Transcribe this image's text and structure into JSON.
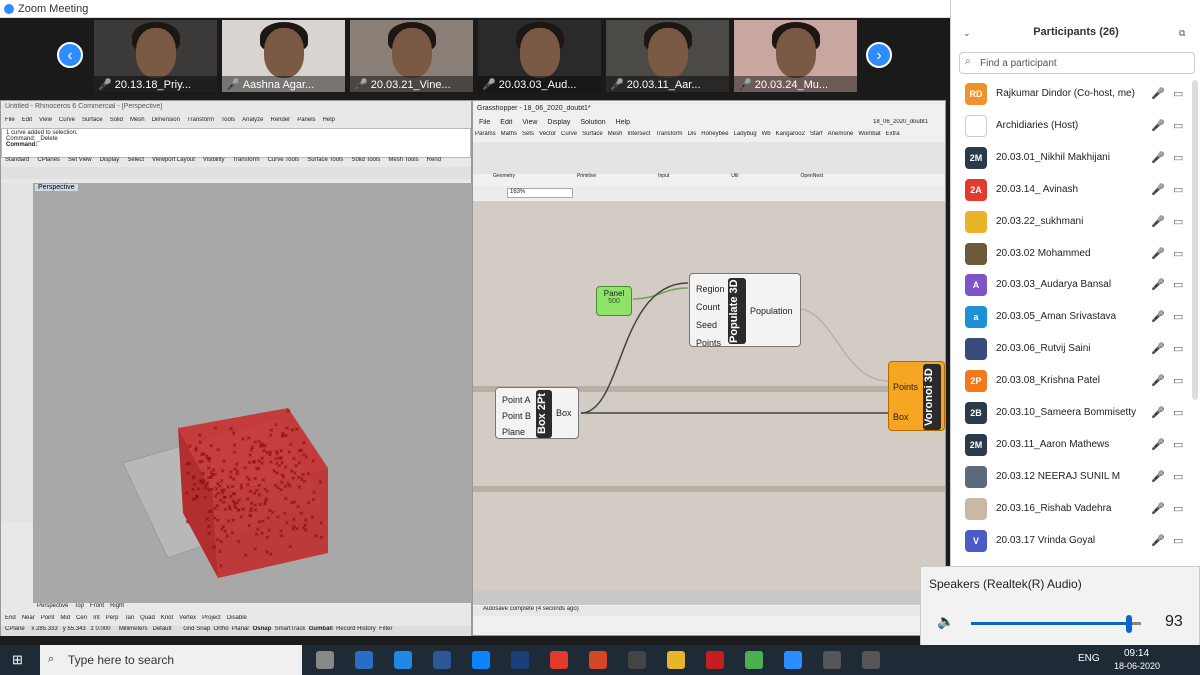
{
  "zoom": {
    "window_title": "Zoom Meeting",
    "accent": "#2d8cff"
  },
  "videos": [
    {
      "label": "20.13.18_Priy...",
      "bg": "#3b3a38"
    },
    {
      "label": "Aashna Agar...",
      "bg": "#d9d4cf"
    },
    {
      "label": "20.03.21_Vine...",
      "bg": "#8a8078"
    },
    {
      "label": "20.03.03_Aud...",
      "bg": "#2a2a2a"
    },
    {
      "label": "20.03.11_Aar...",
      "bg": "#4b4a46"
    },
    {
      "label": "20.03.24_Mu...",
      "bg": "#c9a7a1"
    }
  ],
  "rhino": {
    "title": "Untitled - Rhinoceros 6 Commercial - [Perspective]",
    "menu": [
      "File",
      "Edit",
      "View",
      "Curve",
      "Surface",
      "Solid",
      "Mesh",
      "Dimension",
      "Transform",
      "Tools",
      "Analyze",
      "Render",
      "Panels",
      "Help"
    ],
    "cmd1": "1 curve added to selection.",
    "cmd2": "Command: _Delete",
    "cmd3": "Command:",
    "tabs": [
      "Standard",
      "CPlanes",
      "Set View",
      "Display",
      "Select",
      "Viewport Layout",
      "Visibility",
      "Transform",
      "Curve Tools",
      "Surface Tools",
      "Solid Tools",
      "Mesh Tools",
      "Rend"
    ],
    "viewport_label": "Perspective",
    "view_tabs": [
      "Perspective",
      "Top",
      "Front",
      "Right"
    ],
    "osnaps": [
      "End",
      "Near",
      "Point",
      "Mid",
      "Cen",
      "Int",
      "Perp",
      "Tan",
      "Quad",
      "Knot",
      "Vertex",
      "Project",
      "Disable"
    ],
    "status": {
      "cplane": "CPlane",
      "x": "x 285.333",
      "y": "y 55.343",
      "z": "z 0.000",
      "units": "Millimeters",
      "layer": "Default",
      "grid": "Grid Snap",
      "ortho": "Ortho",
      "planar": "Planar",
      "osnap": "Osnap",
      "smarttrack": "SmartTrack",
      "gumball": "Gumball",
      "history": "Record History",
      "filter": "Filter"
    }
  },
  "gh": {
    "title": "Grasshopper - 18_06_2020_doubt1*",
    "doc": "18_06_2020_doubt1",
    "menu": [
      "File",
      "Edit",
      "View",
      "Display",
      "Solution",
      "Help"
    ],
    "tabs": [
      "Params",
      "Maths",
      "Sets",
      "Vector",
      "Curve",
      "Surface",
      "Mesh",
      "Intersect",
      "Transform",
      "Dis",
      "Honeybee",
      "Ladybug",
      "Wb",
      "Kangaroo2",
      "Starf",
      "Anemone",
      "Wombat",
      "Extra"
    ],
    "groups": [
      "Geometry",
      "Primitive",
      "Input",
      "Util",
      "OpenNest"
    ],
    "zoom": "163%",
    "panel": {
      "title": "Panel",
      "value": "500"
    },
    "populate": {
      "title": "Populate 3D",
      "inputs": [
        "Region",
        "Count",
        "Seed",
        "Points"
      ],
      "output": "Population"
    },
    "box": {
      "title": "Box 2Pt",
      "inputs": [
        "Point A",
        "Point B",
        "Plane"
      ],
      "output": "Box"
    },
    "voronoi": {
      "title": "Voronoi 3D",
      "inputs": [
        "Points",
        "Box"
      ]
    },
    "status": "Autosave complete (4 seconds ago)"
  },
  "participants": {
    "header": "Participants (26)",
    "search_placeholder": "Find a participant",
    "list": [
      {
        "initials": "RD",
        "name": "Rajkumar Dindor (Co-host, me)",
        "color": "#f0922b"
      },
      {
        "initials": "",
        "name": "Archidiaries (Host)",
        "color": "#ffffff"
      },
      {
        "initials": "2M",
        "name": "20.03.01_Nikhil Makhijani",
        "color": "#2b3a4a"
      },
      {
        "initials": "2A",
        "name": "20.03.14_ Avinash",
        "color": "#e23a2c"
      },
      {
        "initials": "",
        "name": "20.03.22_sukhmani",
        "color": "#e8b42a"
      },
      {
        "initials": "",
        "name": "20.03.02 Mohammed",
        "color": "#6b5a3a"
      },
      {
        "initials": "A",
        "name": "20.03.03_Audarya Bansal",
        "color": "#7d55c7"
      },
      {
        "initials": "a",
        "name": "20.03.05_Aman Srivastava",
        "color": "#1e90d6"
      },
      {
        "initials": "",
        "name": "20.03.06_Rutvij Saini",
        "color": "#3a4a7a"
      },
      {
        "initials": "2P",
        "name": "20.03.08_Krishna Patel",
        "color": "#f07a1c"
      },
      {
        "initials": "2B",
        "name": "20.03.10_Sameera Bommisetty",
        "color": "#2b3a4a"
      },
      {
        "initials": "2M",
        "name": "20.03.11_Aaron Mathews",
        "color": "#2b3a4a"
      },
      {
        "initials": "",
        "name": "20.03.12 NEERAJ SUNIL M",
        "color": "#5a6a7a"
      },
      {
        "initials": "",
        "name": "20.03.16_Rishab Vadehra",
        "color": "#c9b8a4"
      },
      {
        "initials": "V",
        "name": "20.03.17 Vrinda Goyal",
        "color": "#4a5bc7"
      }
    ]
  },
  "speaker": {
    "label": "Speakers (Realtek(R) Audio)",
    "volume": "93",
    "level": 93
  },
  "taskbar": {
    "search": "Type here to search",
    "time": "09:14",
    "date": "18-06-2020",
    "lang": "ENG"
  }
}
